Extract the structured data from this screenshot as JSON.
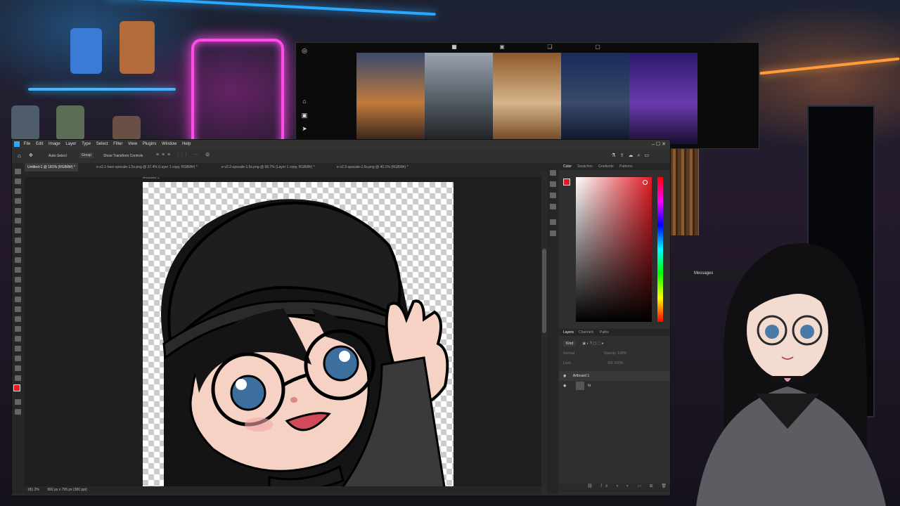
{
  "photoshop": {
    "menu": [
      "File",
      "Edit",
      "Image",
      "Layer",
      "Type",
      "Select",
      "Filter",
      "View",
      "Plugins",
      "Window",
      "Help"
    ],
    "options": {
      "auto_select": "Auto-Select",
      "group": "Group",
      "transform": "Show Transform Controls"
    },
    "tabs": [
      {
        "label": "Untitled-1 @ 181% (RGB/8#) *",
        "active": true
      },
      {
        "label": "e-v2.1-face-upscale-1.5x.png @ 37.4% (Layer 1 copy, RGB/8#) *",
        "active": false
      },
      {
        "label": "e-v2.2-upscale-1.5x.png @ 68.7% (Layer 1 copy, RGB/8#) *",
        "active": false
      },
      {
        "label": "e-v2.3-upscale-1.5x.png @ 40.1% (RGB/8#) *",
        "active": false
      }
    ],
    "artboard_label": "Artboard 1",
    "status": {
      "zoom": "181.2%",
      "doc": "992 px x 795 px (300 ppi)"
    },
    "color_panel_tabs": [
      "Color",
      "Swatches",
      "Gradients",
      "Patterns"
    ],
    "layer_panel_tabs": [
      "Layers",
      "Channels",
      "Paths"
    ],
    "layers": {
      "kind": "Kind",
      "blend": "Normal",
      "opacity": "Opacity: 100%",
      "fill": "Fill: 100%",
      "lock": "Lock:",
      "artboard": "Artboard 1",
      "layer": "hi"
    },
    "fg_color": "#e01b24"
  },
  "messages": {
    "label": "Messages"
  }
}
